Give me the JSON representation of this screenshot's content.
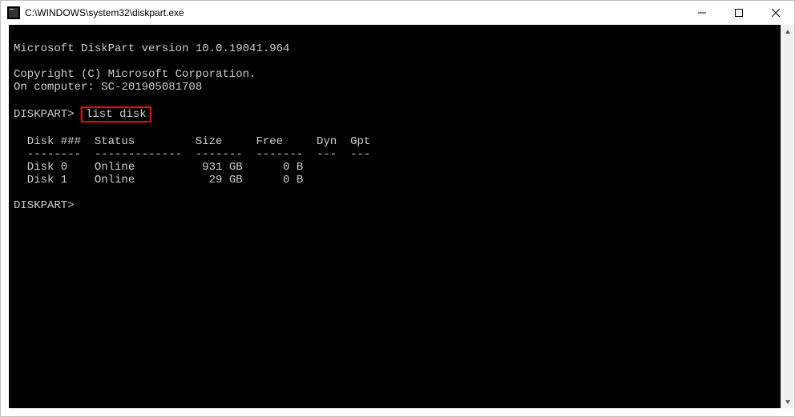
{
  "window": {
    "title": "C:\\WINDOWS\\system32\\diskpart.exe"
  },
  "console": {
    "version_line": "Microsoft DiskPart version 10.0.19041.964",
    "copyright_line": "Copyright (C) Microsoft Corporation.",
    "computer_line": "On computer: SC-201905081708",
    "prompt1_prefix": "DISKPART>",
    "command1": "list disk",
    "header": "  Disk ###  Status         Size     Free     Dyn  Gpt",
    "separator": "  --------  -------------  -------  -------  ---  ---",
    "row0": "  Disk 0    Online          931 GB      0 B",
    "row1": "  Disk 1    Online           29 GB      0 B",
    "prompt2": "DISKPART>"
  }
}
